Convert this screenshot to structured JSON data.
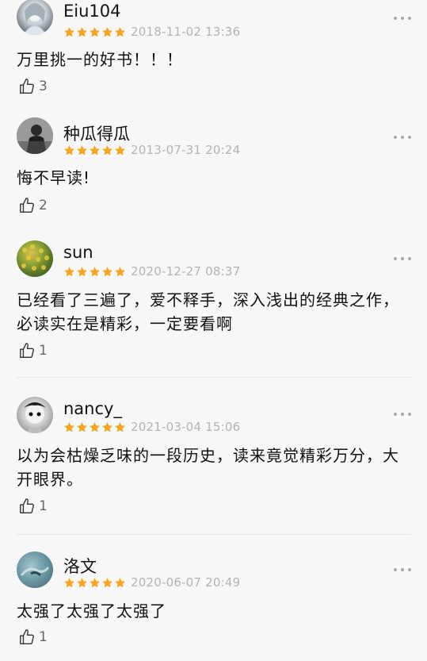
{
  "colors": {
    "star": "#f5a623",
    "date": "#b3b3b3",
    "divider": "#e6e6e6"
  },
  "reviews": [
    {
      "username": "Eiu104",
      "rating": 5,
      "date": "2018-11-02 13:36",
      "text": "万里挑一的好书！！！",
      "likes": "3",
      "like_icon": "thumbs-up-icon",
      "more_icon": "more-icon"
    },
    {
      "username": "种瓜得瓜",
      "rating": 5,
      "date": "2013-07-31 20:24",
      "text": "悔不早读!",
      "likes": "2",
      "like_icon": "thumbs-up-icon",
      "more_icon": "more-icon"
    },
    {
      "username": "sun",
      "rating": 5,
      "date": "2020-12-27 08:37",
      "text": "已经看了三遍了，爱不释手，深入浅出的经典之作，必读实在是精彩，一定要看啊",
      "likes": "1",
      "like_icon": "thumbs-up-icon",
      "more_icon": "more-icon"
    },
    {
      "username": "nancy_",
      "rating": 5,
      "date": "2021-03-04 15:06",
      "text": "以为会枯燥乏味的一段历史，读来竟觉精彩万分，大开眼界。",
      "likes": "1",
      "like_icon": "thumbs-up-icon",
      "more_icon": "more-icon"
    },
    {
      "username": "洛文",
      "rating": 5,
      "date": "2020-06-07 20:49",
      "text": "太强了太强了太强了",
      "likes": "1",
      "like_icon": "thumbs-up-icon",
      "more_icon": "more-icon"
    }
  ]
}
